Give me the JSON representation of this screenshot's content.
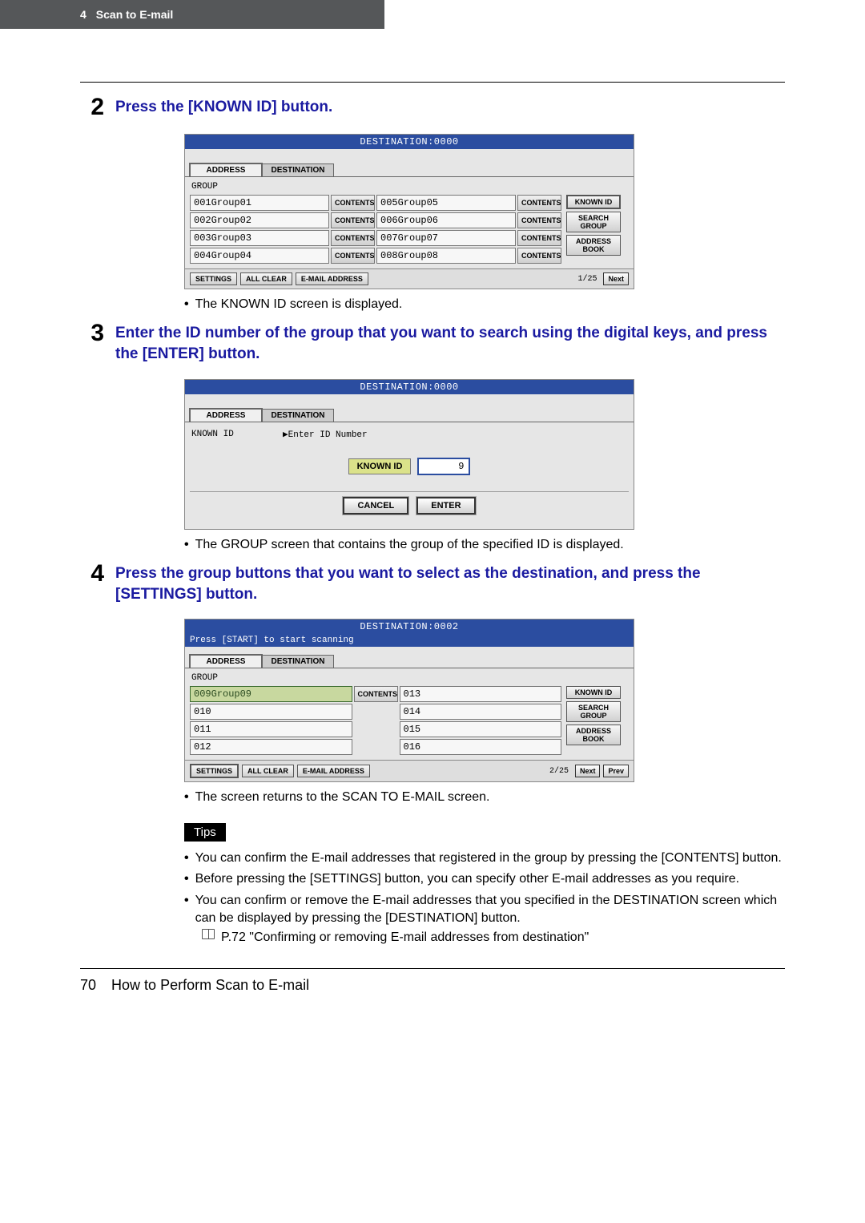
{
  "header": {
    "chapter_num": "4",
    "chapter_title": "Scan to E-mail"
  },
  "step2": {
    "num": "2",
    "text": "Press the [KNOWN ID] button.",
    "bullet": "The KNOWN ID screen is displayed."
  },
  "step3": {
    "num": "3",
    "text": "Enter the ID number of the group that you want to search using the digital keys, and press the [ENTER] button.",
    "bullet": "The GROUP screen that contains the group of the specified ID is displayed."
  },
  "step4": {
    "num": "4",
    "text": "Press the group buttons that you want to select as the destination, and press the [SETTINGS] button.",
    "bullet": "The screen returns to the SCAN TO E-MAIL screen."
  },
  "tips_label": "Tips",
  "tips": [
    "You can confirm the E-mail addresses that registered in the group by pressing the [CONTENTS] button.",
    "Before pressing the [SETTINGS] button, you can specify other E-mail addresses as you require.",
    "You can confirm or remove the E-mail addresses that you specified in the DESTINATION screen which can be displayed by pressing the [DESTINATION] button."
  ],
  "ref": "P.72 \"Confirming or removing E-mail addresses from destination\"",
  "footer": {
    "page": "70",
    "title": "How to Perform Scan to E-mail"
  },
  "shot1": {
    "dest": "DESTINATION:0000",
    "tab_address": "ADDRESS",
    "tab_dest": "DESTINATION",
    "group_label": "GROUP",
    "rows_left": [
      "001Group01",
      "002Group02",
      "003Group03",
      "004Group04"
    ],
    "rows_right": [
      "005Group05",
      "006Group06",
      "007Group07",
      "008Group08"
    ],
    "contents": "CONTENTS",
    "side": {
      "known_id": "KNOWN ID",
      "search_group": "SEARCH GROUP",
      "address_book": "ADDRESS BOOK"
    },
    "bottom": {
      "settings": "SETTINGS",
      "all_clear": "ALL CLEAR",
      "email": "E-MAIL ADDRESS",
      "page": "1/25",
      "next": "Next"
    }
  },
  "shot2": {
    "dest": "DESTINATION:0000",
    "tab_address": "ADDRESS",
    "tab_dest": "DESTINATION",
    "kid_label": "KNOWN ID",
    "kid_prompt": "▶Enter ID Number",
    "kid_button": "KNOWN ID",
    "kid_value": "9",
    "cancel": "CANCEL",
    "enter": "ENTER"
  },
  "shot3": {
    "dest": "DESTINATION:0002",
    "sub": "Press [START] to start scanning",
    "tab_address": "ADDRESS",
    "tab_dest": "DESTINATION",
    "group_label": "GROUP",
    "left": [
      "009Group09",
      "010",
      "011",
      "012"
    ],
    "right": [
      "013",
      "014",
      "015",
      "016"
    ],
    "contents": "CONTENTS",
    "side": {
      "known_id": "KNOWN ID",
      "search_group": "SEARCH GROUP",
      "address_book": "ADDRESS BOOK"
    },
    "bottom": {
      "settings": "SETTINGS",
      "all_clear": "ALL CLEAR",
      "email": "E-MAIL ADDRESS",
      "page": "2/25",
      "next": "Next",
      "prev": "Prev"
    }
  }
}
